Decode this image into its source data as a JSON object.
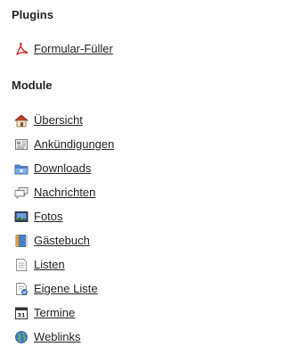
{
  "plugins": {
    "title": "Plugins",
    "items": [
      {
        "label": "Formular-Füller",
        "icon": "pdf-icon"
      }
    ]
  },
  "module": {
    "title": "Module",
    "items": [
      {
        "label": "Übersicht",
        "icon": "home-icon"
      },
      {
        "label": "Ankündigungen",
        "icon": "announcement-icon"
      },
      {
        "label": "Downloads",
        "icon": "folder-icon"
      },
      {
        "label": "Nachrichten",
        "icon": "messages-icon"
      },
      {
        "label": "Fotos",
        "icon": "photo-icon"
      },
      {
        "label": "Gästebuch",
        "icon": "guestbook-icon"
      },
      {
        "label": "Listen",
        "icon": "list-icon"
      },
      {
        "label": "Eigene Liste",
        "icon": "custom-list-icon"
      },
      {
        "label": "Termine",
        "icon": "calendar-icon"
      },
      {
        "label": "Weblinks",
        "icon": "globe-icon"
      }
    ]
  }
}
